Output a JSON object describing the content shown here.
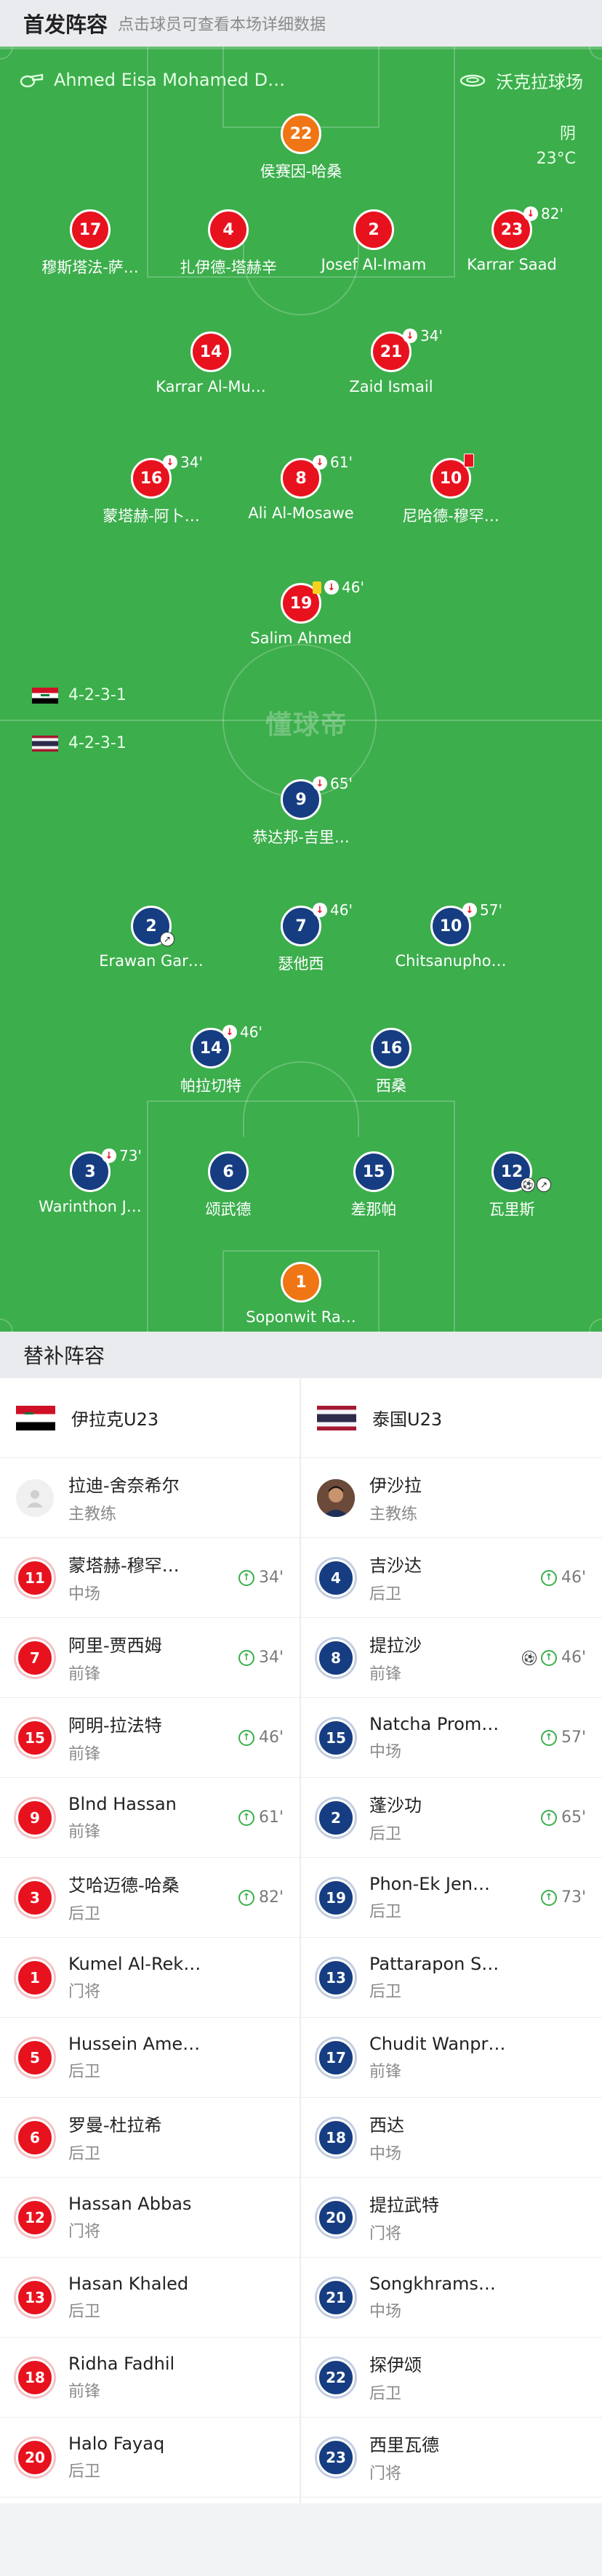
{
  "header": {
    "title": "首发阵容",
    "subtitle": "点击球员可查看本场详细数据"
  },
  "pitch": {
    "referee": "Ahmed Eisa Mohamed D…",
    "stadium": "沃克拉球场",
    "weather": "阴",
    "temperature": "23°C",
    "watermark": "懂球帝",
    "home_formation": "4-2-3-1",
    "away_formation": "4-2-3-1"
  },
  "home_lineup": [
    {
      "num": "22",
      "name": "侯赛因-哈桑",
      "color": "orange"
    },
    {
      "num": "17",
      "name": "穆斯塔法-萨…",
      "color": "red"
    },
    {
      "num": "4",
      "name": "扎伊德-塔赫辛",
      "color": "red"
    },
    {
      "num": "2",
      "name": "Josef Al-Imam",
      "color": "red"
    },
    {
      "num": "23",
      "name": "Karrar Saad",
      "color": "red",
      "sub_out": "82'"
    },
    {
      "num": "14",
      "name": "Karrar Al-Mu…",
      "color": "red"
    },
    {
      "num": "21",
      "name": "Zaid Ismail",
      "color": "red",
      "sub_out": "34'"
    },
    {
      "num": "16",
      "name": "蒙塔赫-阿卜…",
      "color": "red",
      "sub_out": "34'"
    },
    {
      "num": "8",
      "name": "Ali Al-Mosawe",
      "color": "red",
      "sub_out": "61'"
    },
    {
      "num": "10",
      "name": "尼哈德-穆罕…",
      "color": "red",
      "red_card": true
    },
    {
      "num": "19",
      "name": "Salim Ahmed",
      "color": "red",
      "yellow_card": true,
      "sub_out": "46'"
    }
  ],
  "away_lineup": [
    {
      "num": "9",
      "name": "恭达邦-吉里…",
      "color": "blue",
      "sub_out": "65'"
    },
    {
      "num": "2",
      "name": "Erawan Gar…",
      "color": "blue",
      "assist": true
    },
    {
      "num": "7",
      "name": "瑟他西",
      "color": "blue",
      "sub_out": "46'"
    },
    {
      "num": "10",
      "name": "Chitsanupho…",
      "color": "blue",
      "sub_out": "57'"
    },
    {
      "num": "14",
      "name": "帕拉切特",
      "color": "blue",
      "sub_out": "46'"
    },
    {
      "num": "16",
      "name": "西桑",
      "color": "blue"
    },
    {
      "num": "3",
      "name": "Warinthon J…",
      "color": "blue",
      "sub_out": "73'"
    },
    {
      "num": "6",
      "name": "颂武德",
      "color": "blue"
    },
    {
      "num": "15",
      "name": "差那帕",
      "color": "blue"
    },
    {
      "num": "12",
      "name": "瓦里斯",
      "color": "blue",
      "goal": true,
      "assist": true
    },
    {
      "num": "1",
      "name": "Soponwit Ra…",
      "color": "orange"
    }
  ],
  "subs": {
    "title": "替补阵容",
    "home": {
      "team": "伊拉克U23",
      "coach": {
        "name": "拉迪-舍奈希尔",
        "role": "主教练"
      },
      "players": [
        {
          "num": "11",
          "name": "蒙塔赫-穆罕…",
          "pos": "中场",
          "in": "34'"
        },
        {
          "num": "7",
          "name": "阿里-贾西姆",
          "pos": "前锋",
          "in": "34'"
        },
        {
          "num": "15",
          "name": "阿明-拉法特",
          "pos": "前锋",
          "in": "46'"
        },
        {
          "num": "9",
          "name": "Blnd Hassan",
          "pos": "前锋",
          "in": "61'"
        },
        {
          "num": "3",
          "name": "艾哈迈德-哈桑",
          "pos": "后卫",
          "in": "82'"
        },
        {
          "num": "1",
          "name": "Kumel Al-Rek…",
          "pos": "门将"
        },
        {
          "num": "5",
          "name": "Hussein Ame…",
          "pos": "后卫"
        },
        {
          "num": "6",
          "name": "罗曼-杜拉希",
          "pos": "后卫"
        },
        {
          "num": "12",
          "name": "Hassan Abbas",
          "pos": "门将"
        },
        {
          "num": "13",
          "name": "Hasan Khaled",
          "pos": "后卫"
        },
        {
          "num": "18",
          "name": "Ridha Fadhil",
          "pos": "前锋"
        },
        {
          "num": "20",
          "name": "Halo Fayaq",
          "pos": "后卫"
        }
      ]
    },
    "away": {
      "team": "泰国U23",
      "coach": {
        "name": "伊沙拉",
        "role": "主教练"
      },
      "players": [
        {
          "num": "4",
          "name": "吉沙达",
          "pos": "后卫",
          "in": "46'"
        },
        {
          "num": "8",
          "name": "提拉沙",
          "pos": "前锋",
          "in": "46'",
          "goal": true
        },
        {
          "num": "15",
          "name": "Natcha Prom…",
          "pos": "中场",
          "in": "57'"
        },
        {
          "num": "2",
          "name": "蓬沙功",
          "pos": "后卫",
          "in": "65'"
        },
        {
          "num": "19",
          "name": "Phon-Ek Jen…",
          "pos": "后卫",
          "in": "73'"
        },
        {
          "num": "13",
          "name": "Pattarapon S…",
          "pos": "后卫"
        },
        {
          "num": "17",
          "name": "Chudit Wanpr…",
          "pos": "前锋"
        },
        {
          "num": "18",
          "name": "西达",
          "pos": "中场"
        },
        {
          "num": "20",
          "name": "提拉武特",
          "pos": "门将"
        },
        {
          "num": "21",
          "name": "Songkhrams…",
          "pos": "中场"
        },
        {
          "num": "22",
          "name": "探伊颂",
          "pos": "后卫"
        },
        {
          "num": "23",
          "name": "西里瓦德",
          "pos": "门将"
        }
      ]
    }
  }
}
